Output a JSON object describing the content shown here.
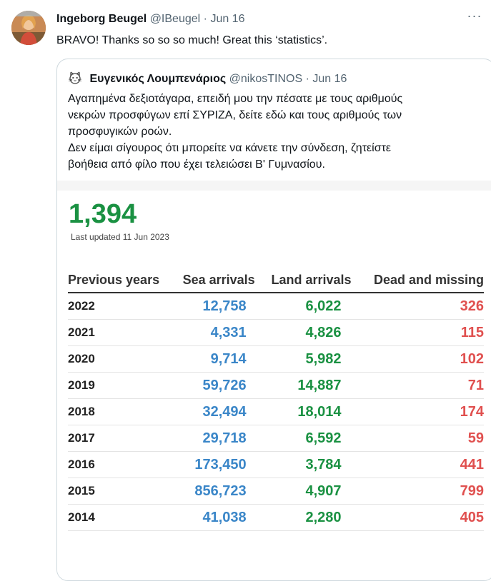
{
  "tweet": {
    "author_name": "Ingeborg Beugel",
    "handle": "@IBeugel",
    "separator": "·",
    "date": "Jun 16",
    "text": "BRAVO! Thanks so so so much! Great this ‘statistics’.",
    "more_label": "···"
  },
  "quote": {
    "author_name": "Ευγενικός Λουμπενάριος",
    "handle": "@nikosTINOS",
    "separator": "·",
    "date": "Jun 16",
    "lines": [
      "Αγαπημένα δεξιοτάγαρα, επειδή μου την πέσατε με τους αριθμούς",
      "νεκρών προσφύγων επί ΣΥΡΙΖΑ, δείτε εδώ και τους αριθμούς των",
      "προσφυγικών ροών.",
      "Δεν είμαι σίγουρος ότι μπορείτε να κάνετε την σύνδεση, ζητείστε",
      "βοήθεια από φίλο που έχει τελειώσει Β' Γυμνασίου."
    ]
  },
  "stats": {
    "big_number": "1,394",
    "last_updated": "Last updated 11 Jun 2023",
    "headers": [
      "Previous years",
      "Sea arrivals",
      "Land arrivals",
      "Dead and missing"
    ],
    "rows": [
      {
        "year": "2022",
        "sea": "12,758",
        "land": "6,022",
        "dead": "326"
      },
      {
        "year": "2021",
        "sea": "4,331",
        "land": "4,826",
        "dead": "115"
      },
      {
        "year": "2020",
        "sea": "9,714",
        "land": "5,982",
        "dead": "102"
      },
      {
        "year": "2019",
        "sea": "59,726",
        "land": "14,887",
        "dead": "71"
      },
      {
        "year": "2018",
        "sea": "32,494",
        "land": "18,014",
        "dead": "174"
      },
      {
        "year": "2017",
        "sea": "29,718",
        "land": "6,592",
        "dead": "59"
      },
      {
        "year": "2016",
        "sea": "173,450",
        "land": "3,784",
        "dead": "441"
      },
      {
        "year": "2015",
        "sea": "856,723",
        "land": "4,907",
        "dead": "799"
      },
      {
        "year": "2014",
        "sea": "41,038",
        "land": "2,280",
        "dead": "405"
      }
    ]
  },
  "colors": {
    "sea": "#3a86c8",
    "land": "#1a9142",
    "dead": "#e0504f",
    "muted": "#536471"
  },
  "icons": {
    "more": "more-horizontal-icon",
    "quoted_avatar": "cat-face-avatar"
  }
}
